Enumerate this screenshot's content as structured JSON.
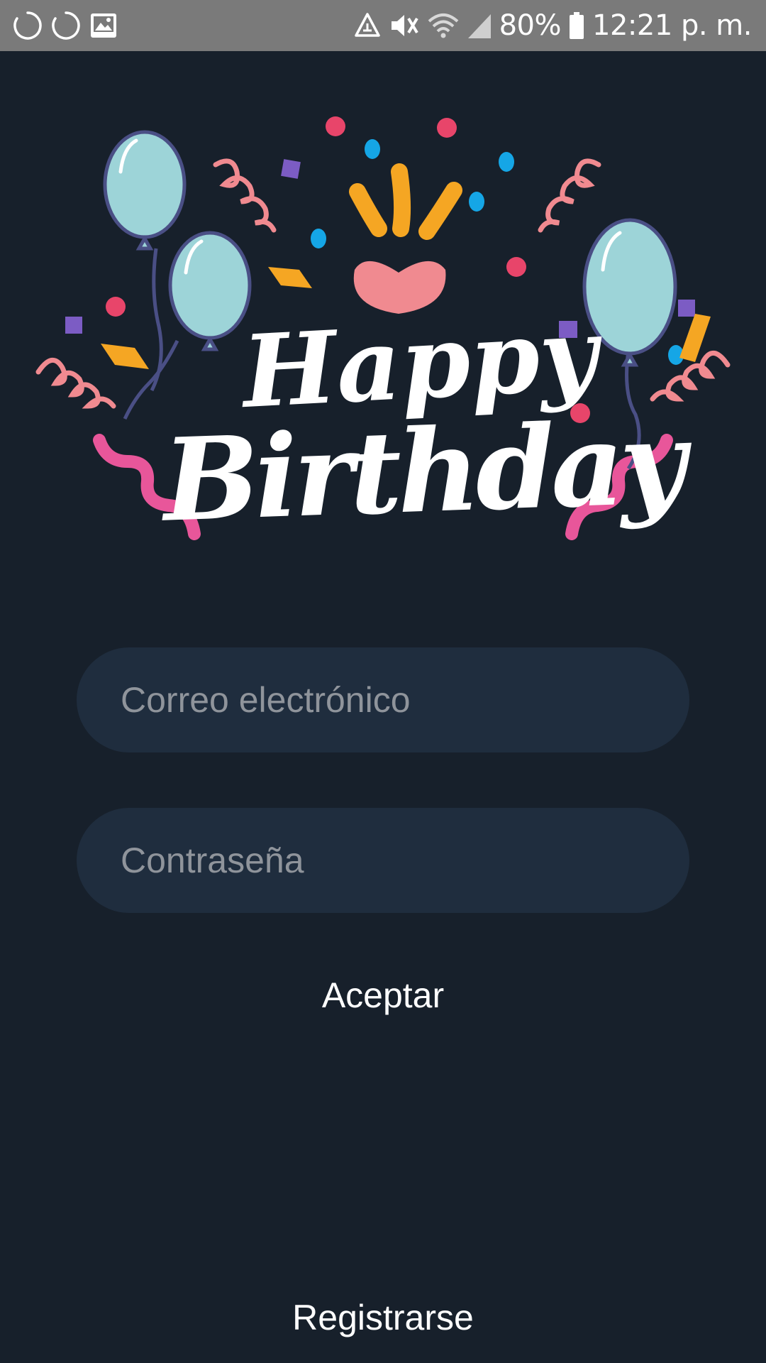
{
  "status_bar": {
    "left_icons": [
      "loading-icon",
      "loading-icon",
      "image-icon"
    ],
    "right_icons": [
      "recycle-icon",
      "mute-icon",
      "wifi-icon",
      "signal-icon",
      "battery-icon"
    ],
    "battery_percent": "80%",
    "time": "12:21 p. m."
  },
  "hero": {
    "line1": "Happy",
    "line2": "Birthday"
  },
  "form": {
    "email_placeholder": "Correo electrónico",
    "password_placeholder": "Contraseña",
    "accept_label": "Aceptar",
    "register_label": "Registrarse"
  },
  "colors": {
    "background": "#17202b",
    "field_background": "#1f2d3e",
    "placeholder": "#8f949b",
    "status_bar": "#7a7a7a"
  }
}
